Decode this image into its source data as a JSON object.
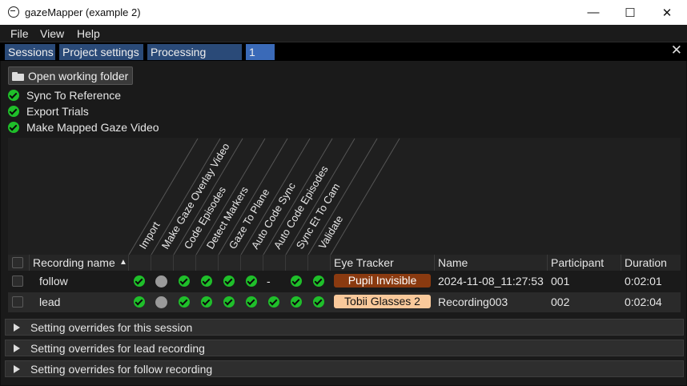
{
  "window": {
    "title": "gazeMapper (example 2)",
    "minimize": "—",
    "maximize": "☐",
    "close": "✕"
  },
  "menu": [
    "File",
    "View",
    "Help"
  ],
  "tabs": [
    {
      "label": "Sessions",
      "active": false
    },
    {
      "label": "Project settings",
      "active": false
    },
    {
      "label": "Processing queue",
      "active": false
    },
    {
      "label": "1",
      "active": true
    }
  ],
  "tab_close": "✕",
  "open_folder_label": "Open working folder",
  "actions": [
    "Sync To Reference",
    "Export Trials",
    "Make Mapped Gaze Video"
  ],
  "status_columns": [
    "Import",
    "Make Gaze Overlay Video",
    "Code Episodes",
    "Detect Markers",
    "Gaze To Plane",
    "Auto Code Sync",
    "Auto Code Episodes",
    "Sync Et To Cam",
    "Validate"
  ],
  "table": {
    "headers": {
      "recording_name": "Recording name",
      "sort_indicator": "▲",
      "eye_tracker": "Eye Tracker",
      "name": "Name",
      "participant": "Participant",
      "duration": "Duration"
    },
    "rows": [
      {
        "recording_name": "follow",
        "status": [
          "done",
          "gray",
          "done",
          "done",
          "done",
          "done",
          "dash",
          "done",
          "done"
        ],
        "dash": "-",
        "eye_tracker": "Pupil Invisible",
        "tracker_color": "#8a3a10",
        "tracker_text_color": "#ffffff",
        "name": "2024-11-08_11:27:53",
        "participant": "001",
        "duration": "0:02:01"
      },
      {
        "recording_name": "lead",
        "status": [
          "done",
          "gray",
          "done",
          "done",
          "done",
          "done",
          "done",
          "done",
          "done"
        ],
        "eye_tracker": "Tobii Glasses 2",
        "tracker_color": "#f9c99b",
        "tracker_text_color": "#111111",
        "name": "Recording003",
        "participant": "002",
        "duration": "0:02:04"
      }
    ]
  },
  "overrides": [
    "Setting overrides for this session",
    "Setting overrides for lead recording",
    "Setting overrides for follow recording"
  ],
  "colors": {
    "done": "#1fbf2a",
    "pending": "#9a9a9a",
    "tab": "#2a4a78",
    "tab_active": "#3a6ab8"
  }
}
